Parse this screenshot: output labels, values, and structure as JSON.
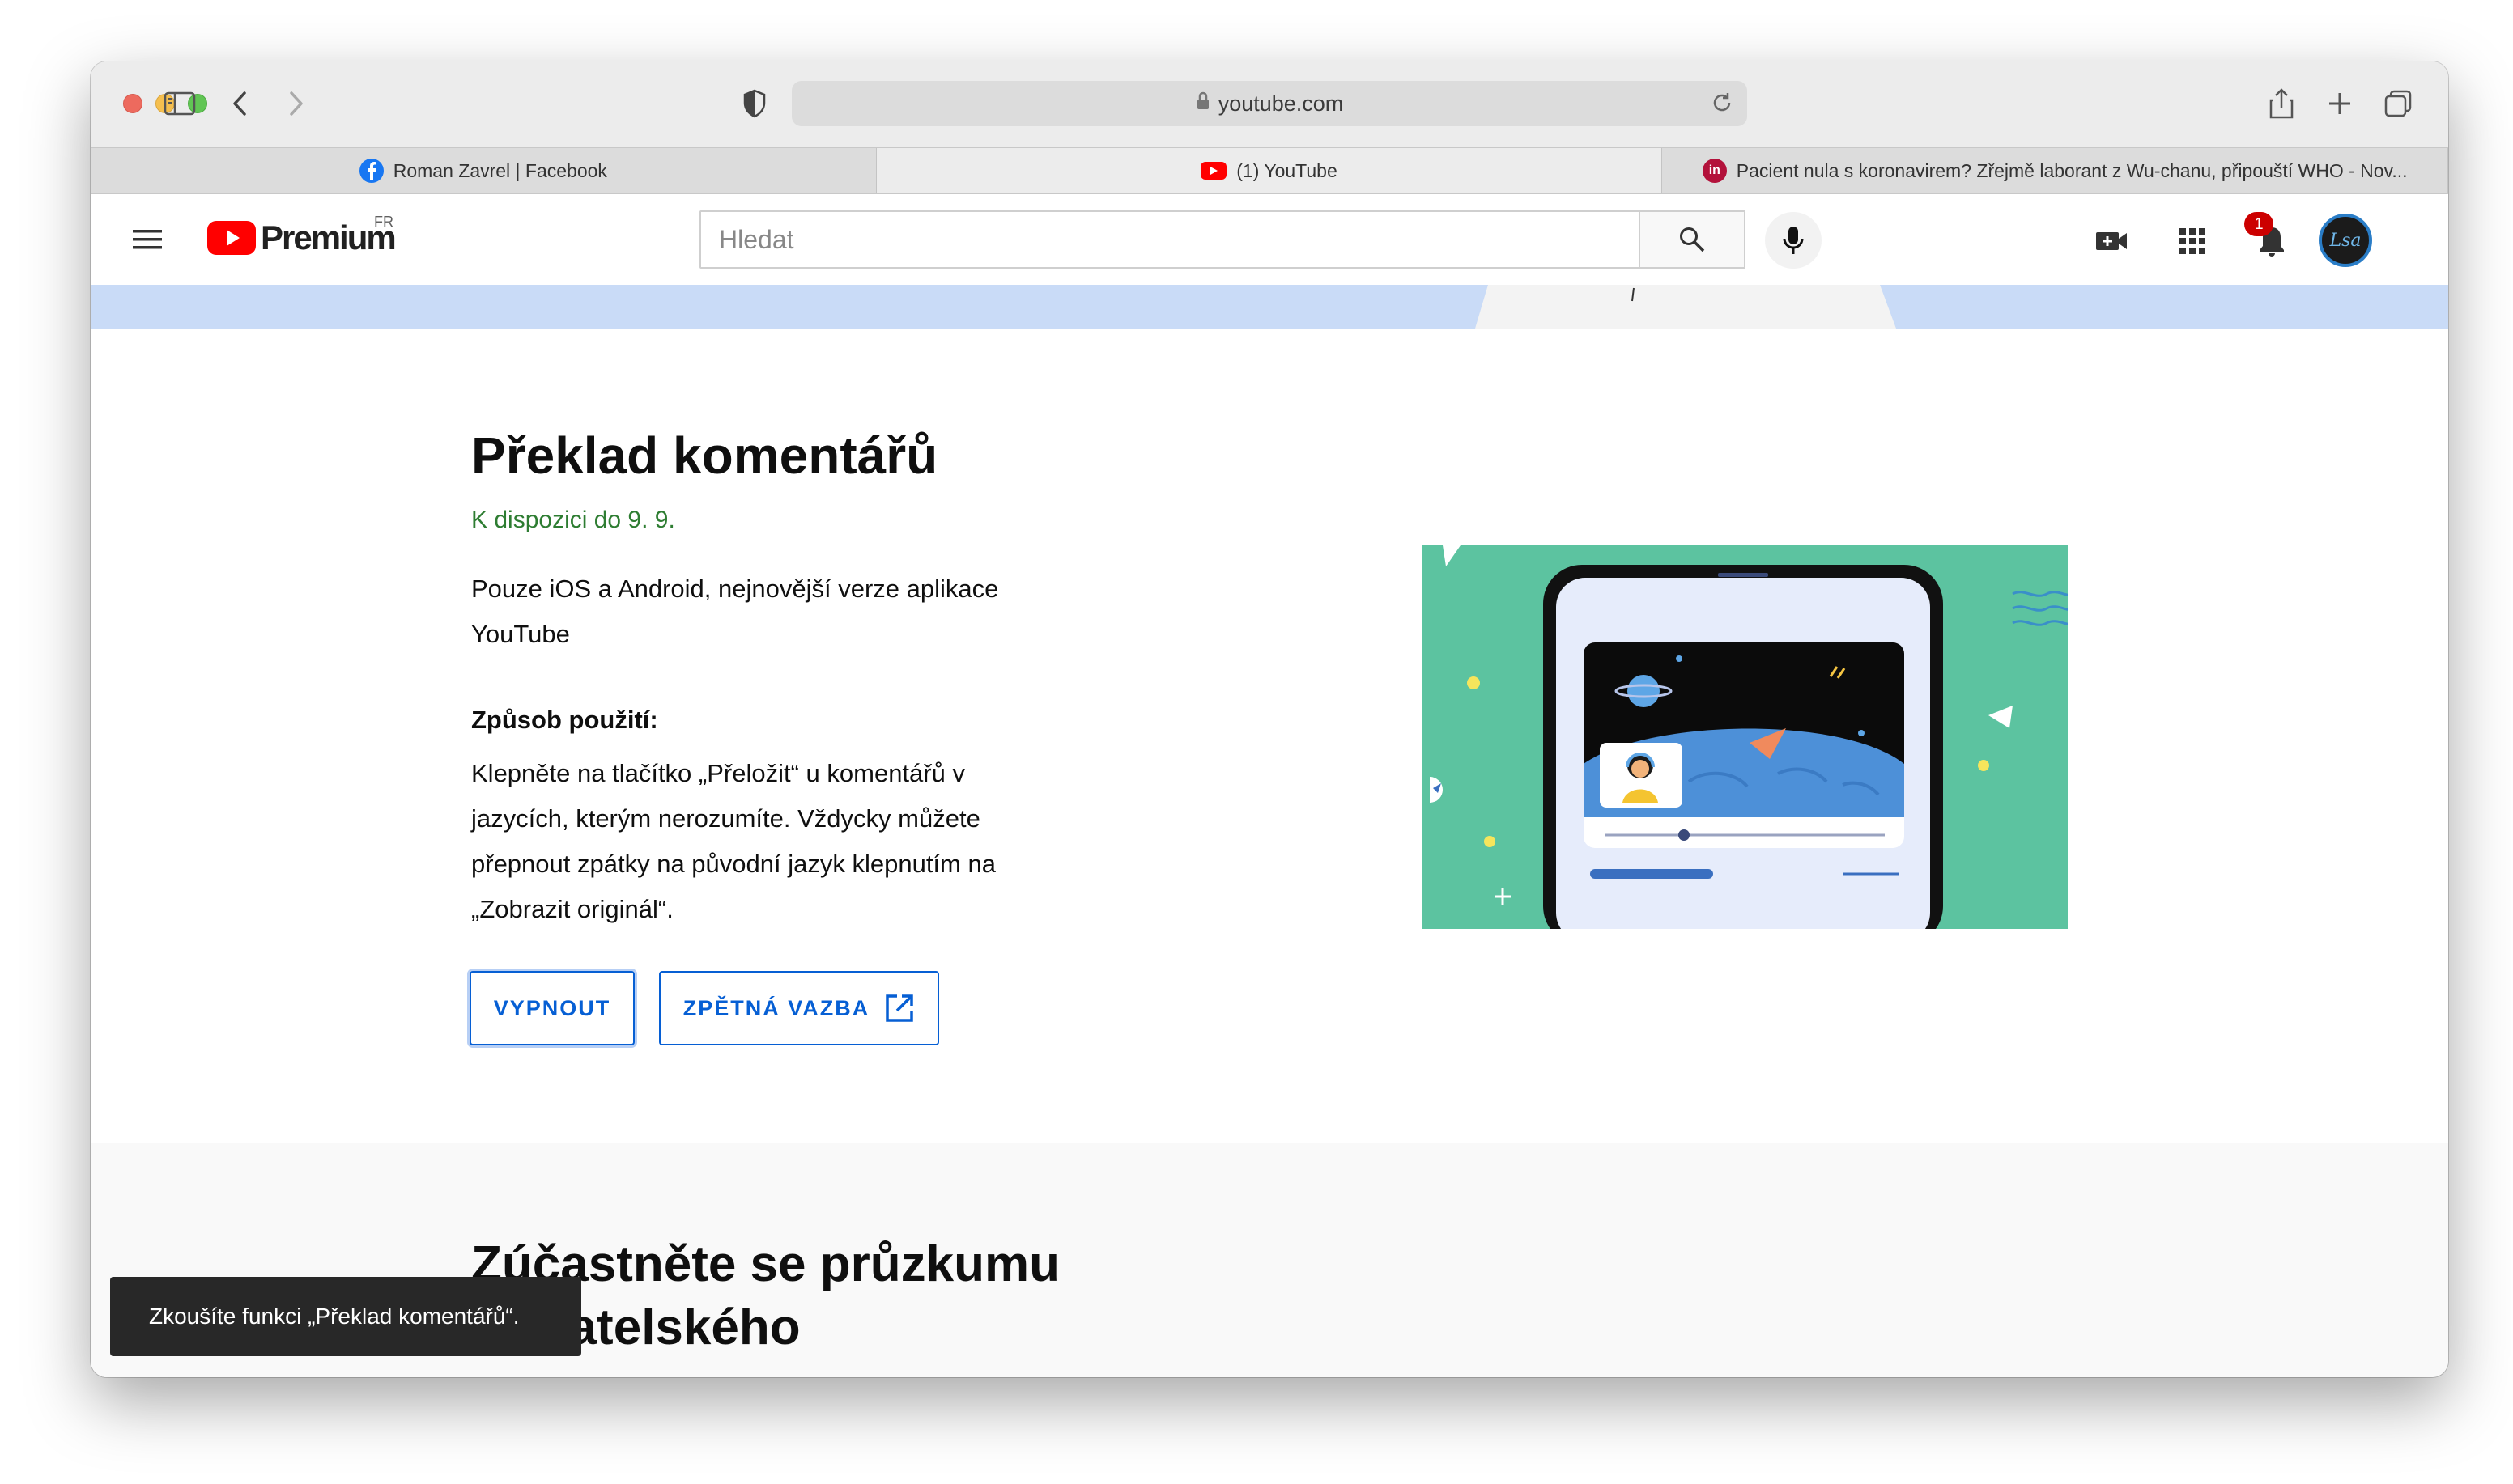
{
  "browser": {
    "address": "youtube.com",
    "tabs": [
      {
        "label": "Roman Zavrel | Facebook",
        "icon": "facebook-icon"
      },
      {
        "label": "(1) YouTube",
        "icon": "youtube-icon"
      },
      {
        "label": "Pacient nula s koronavirem? Zřejmě laborant z Wu-chanu, připouští WHO - Nov...",
        "icon": "news-icon"
      }
    ]
  },
  "header": {
    "logo_text": "Premium",
    "logo_region": "FR",
    "search_placeholder": "Hledat",
    "notification_count": "1",
    "avatar_initials": "Lsa"
  },
  "feature": {
    "title": "Překlad komentářů",
    "availability": "K dispozici do 9. 9.",
    "platform_note": "Pouze iOS a Android, nejnovější verze aplikace YouTube",
    "howto_heading": "Způsob použití:",
    "howto_text": "Klepněte na tlačítko „Přeložit“ u komentářů v jazycích, kterým nerozumíte. Vždycky můžete přepnout zpátky na původní jazyk klepnutím na „Zobrazit originál“.",
    "button_off": "VYPNOUT",
    "button_feedback": "ZPĚTNÁ VAZBA"
  },
  "next_section": {
    "title": "Zúčastněte se průzkumu uživatelského"
  },
  "toast": {
    "message": "Zkoušíte funkci „Překlad komentářů“."
  },
  "colors": {
    "accent": "#065fd4",
    "availability": "#2e7d32",
    "youtube_red": "#ff0000",
    "banner": "#c9dbf7",
    "illustration_bg": "#5cc3a0"
  }
}
